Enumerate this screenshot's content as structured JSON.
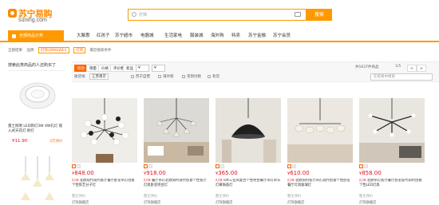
{
  "header": {
    "logo_cn": "苏宁易购",
    "logo_en": "suning.com",
    "search_placeholder": "灯饰",
    "search_button": "搜索"
  },
  "nav": {
    "category_button": "全部商品分类",
    "items": [
      "大聚惠",
      "红孩子",
      "苏宁超市",
      "电器城",
      "生活家电",
      "服装城",
      "海外购",
      "特卖",
      "苏宁金融",
      "苏宁会员"
    ]
  },
  "breadcrumb": [
    "全部结果",
    "品牌",
    "灯饰(DINGWEI)",
    "灯饰",
    "最近搜索条件"
  ],
  "filter": {
    "sort": [
      "综合",
      "销量",
      "价格",
      "评价数",
      "新品"
    ],
    "price_from": "¥",
    "price_to": "¥",
    "pager": "1/5",
    "pager_prev": "<",
    "pager_next": ">",
    "page_count": "共1637件商品",
    "ship_label": "收货地",
    "ship_value": "江苏南京",
    "checks": [
      "苏宁自营",
      "海外购",
      "货到付款",
      "有货"
    ],
    "in_search_placeholder": "在结果中搜索"
  },
  "sidebar": {
    "title": "搜索此类商品的人还购买了",
    "products": [
      {
        "name": "雷士照明 LED筒灯3W 4W孔灯 嵌入式天花灯 射灯",
        "price": "¥11.90",
        "count": "3万评价"
      },
      {
        "name": "",
        "price": "",
        "count": ""
      }
    ]
  },
  "products": [
    {
      "price": "848.00",
      "brand": "灯饰",
      "title": "北欧现代简约客厅餐厅卧室吊灯创意个性铁艺分子灯",
      "reviews": "暂无评价",
      "store": "灯饰旗舰店"
    },
    {
      "price": "918.00",
      "brand": "灯饰",
      "title": "餐厅吊灯北欧简约现代创意个性客厅灯具卧室吧台灯",
      "reviews": "暂无评价",
      "store": "灯饰旗舰店"
    },
    {
      "price": "365.00",
      "brand": "灯饰",
      "title": "loft工业风复古个性吧台餐厅吊灯单头灯罩锅盖灯",
      "reviews": "暂无评价",
      "store": "灯饰旗舰店"
    },
    {
      "price": "610.00",
      "brand": "灯饰",
      "title": "北欧简约客厅吊灯现代创意个性卧室餐厅灯具玻璃灯",
      "reviews": "暂无评价",
      "store": "灯饰旗舰店"
    },
    {
      "price": "858.00",
      "brand": "灯饰",
      "title": "北欧吊灯客厅餐厅卧室现代简约创意个性LED灯具",
      "reviews": "暂无评价",
      "store": "灯饰旗舰店"
    }
  ],
  "colors": {
    "accent": "#ff9900",
    "price": "#e3101e"
  }
}
